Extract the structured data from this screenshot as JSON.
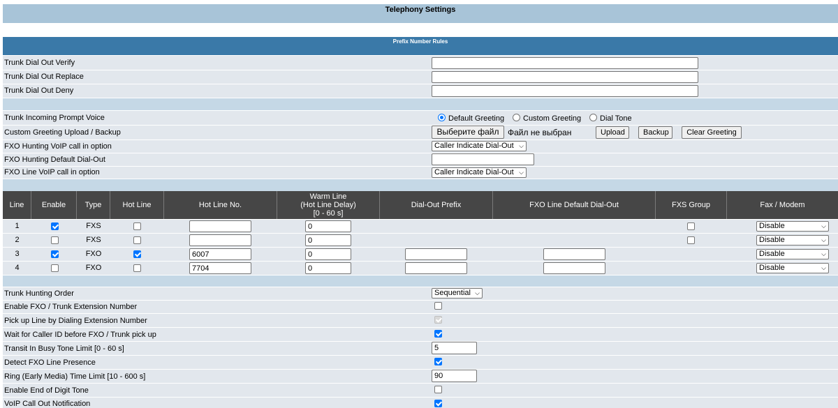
{
  "page": {
    "title": "Telephony Settings"
  },
  "prefix": {
    "title": "Prefix Number Rules",
    "rows": [
      {
        "label": "Trunk Dial Out Verify",
        "value": ""
      },
      {
        "label": "Trunk Dial Out Replace",
        "value": ""
      },
      {
        "label": "Trunk Dial Out Deny",
        "value": ""
      }
    ]
  },
  "voice": {
    "prompt_label": "Trunk Incoming Prompt Voice",
    "options": [
      "Default Greeting",
      "Custom Greeting",
      "Dial Tone"
    ],
    "selected": "Default Greeting",
    "upload_label": "Custom Greeting Upload / Backup",
    "choose_file": "Выберите файл",
    "no_file": "Файл не выбран",
    "upload_btn": "Upload",
    "backup_btn": "Backup",
    "clear_btn": "Clear Greeting",
    "fxo_hunting_label": "FXO Hunting VoIP call in option",
    "fxo_hunting_value": "Caller Indicate Dial-Out",
    "fxo_default_label": "FXO Hunting Default Dial-Out",
    "fxo_default_value": "",
    "fxo_line_label": "FXO Line VoIP call in option",
    "fxo_line_value": "Caller Indicate Dial-Out"
  },
  "lines": {
    "headers": [
      "Line",
      "Enable",
      "Type",
      "Hot Line",
      "Hot Line No.",
      "Warm Line",
      "(Hot Line Delay)",
      "[0 - 60 s]",
      "Dial-Out Prefix",
      "FXO Line Default Dial-Out",
      "FXS Group",
      "Fax / Modem"
    ],
    "rows": [
      {
        "line": "1",
        "enable": true,
        "type": "FXS",
        "hot_line": false,
        "hot_line_no": "",
        "warm_line": "0",
        "fax": "Disable"
      },
      {
        "line": "2",
        "enable": false,
        "type": "FXS",
        "hot_line": false,
        "hot_line_no": "",
        "warm_line": "0",
        "fax": "Disable"
      },
      {
        "line": "3",
        "enable": true,
        "type": "FXO",
        "hot_line": true,
        "hot_line_no": "6007",
        "warm_line": "0",
        "fax": "Disable"
      },
      {
        "line": "4",
        "enable": false,
        "type": "FXO",
        "hot_line": false,
        "hot_line_no": "7704",
        "warm_line": "0",
        "fax": "Disable"
      }
    ]
  },
  "options": {
    "hunting_order_label": "Trunk Hunting Order",
    "hunting_order_value": "Sequential",
    "rows": [
      {
        "label": "Enable FXO / Trunk Extension Number",
        "checked": false
      },
      {
        "label": "Pick up Line by Dialing Extension Number",
        "checked": true,
        "disabled": true
      },
      {
        "label": "Wait for Caller ID before FXO / Trunk pick up",
        "checked": true
      },
      {
        "label": "Transit In Busy Tone Limit [0 - 60 s]",
        "value": "5"
      },
      {
        "label": "Detect FXO Line Presence",
        "checked": true
      },
      {
        "label": "Ring (Early Media) Time Limit [10 - 600 s]",
        "value": "90"
      },
      {
        "label": "Enable End of Digit Tone",
        "checked": false
      },
      {
        "label": "VoIP Call Out Notification",
        "checked": true
      }
    ]
  }
}
